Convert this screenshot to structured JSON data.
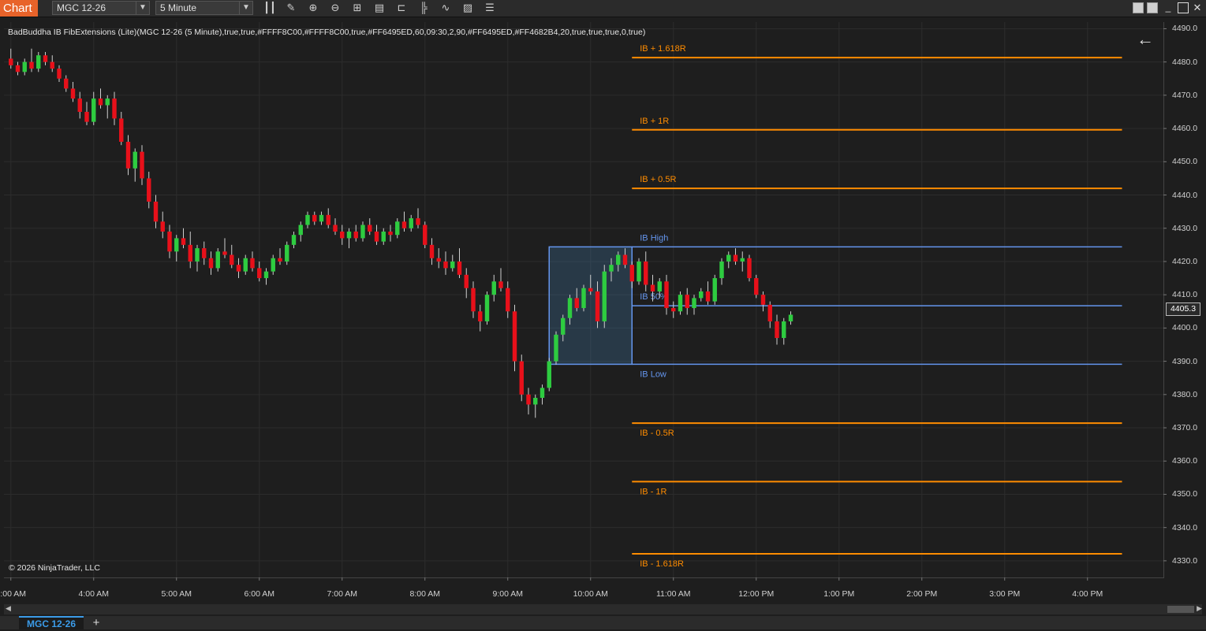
{
  "toolbar": {
    "app_tab": "Chart",
    "instrument": "MGC 12-26",
    "interval": "5 Minute",
    "icons": [
      "bar-type-icon",
      "draw-pencil-icon",
      "zoom-in-icon",
      "zoom-out-icon",
      "crosshair-icon",
      "data-box-icon",
      "strategy-icon",
      "indicator-icon",
      "trend-line-icon",
      "properties-icon",
      "list-icon"
    ]
  },
  "indicator_label": "BadBuddha IB FibExtensions (Lite)(MGC 12-26 (5 Minute),true,true,#FFFF8C00,#FFFF8C00,true,#FF6495ED,60,09:30,2,90,#FF6495ED,#FF4682B4,20,true,true,true,0,true)",
  "copyright": "© 2026 NinjaTrader, LLC",
  "last_price": "4405.3",
  "price_ticks": [
    "4490.0",
    "4480.0",
    "4470.0",
    "4460.0",
    "4450.0",
    "4440.0",
    "4430.0",
    "4420.0",
    "4410.0",
    "4400.0",
    "4390.0",
    "4380.0",
    "4370.0",
    "4360.0",
    "4350.0",
    "4340.0",
    "4330.0"
  ],
  "time_ticks": [
    "3:00 AM",
    "4:00 AM",
    "5:00 AM",
    "6:00 AM",
    "7:00 AM",
    "8:00 AM",
    "9:00 AM",
    "10:00 AM",
    "11:00 AM",
    "12:00 PM",
    "1:00 PM",
    "2:00 PM",
    "3:00 PM",
    "4:00 PM"
  ],
  "bottom_tab": "MGC 12-26",
  "add_tab": "+",
  "colors": {
    "up": "#2ecc40",
    "down": "#e8101a",
    "fib": "#ff8c00",
    "ib": "#6495ed",
    "ibfill": "#4682b4",
    "bg": "#1e1e1e",
    "grid": "#2c2c2c"
  },
  "chart_data": {
    "type": "candlestick",
    "y_range": [
      4325,
      4492
    ],
    "x_range": [
      "02:55",
      "16:55"
    ],
    "levels": [
      {
        "label": "IB + 1.618R",
        "price": 4481.3,
        "kind": "fib"
      },
      {
        "label": "IB + 1R",
        "price": 4459.6,
        "kind": "fib"
      },
      {
        "label": "IB + 0.5R",
        "price": 4442.0,
        "kind": "fib"
      },
      {
        "label": "IB High",
        "price": 4424.4,
        "kind": "ib"
      },
      {
        "label": "IB 50%",
        "price": 4406.7,
        "kind": "ib"
      },
      {
        "label": "IB Low",
        "price": 4389.1,
        "kind": "ib"
      },
      {
        "label": "IB - 0.5R",
        "price": 4371.4,
        "kind": "fib"
      },
      {
        "label": "IB - 1R",
        "price": 4353.8,
        "kind": "fib"
      },
      {
        "label": "IB - 1.618R",
        "price": 4332.1,
        "kind": "fib"
      }
    ],
    "ib_window": {
      "start": "09:30",
      "end": "10:30",
      "high": 4424.4,
      "low": 4389.1
    },
    "candles": [
      [
        4481,
        4484,
        4478,
        4479
      ],
      [
        4479,
        4480,
        4476,
        4477
      ],
      [
        4477,
        4481,
        4476,
        4480
      ],
      [
        4480,
        4484,
        4477,
        4478
      ],
      [
        4478,
        4483,
        4477,
        4482
      ],
      [
        4482,
        4483,
        4479,
        4480
      ],
      [
        4480,
        4482,
        4477,
        4478
      ],
      [
        4478,
        4479,
        4474,
        4475
      ],
      [
        4475,
        4476,
        4471,
        4472
      ],
      [
        4472,
        4474,
        4468,
        4469
      ],
      [
        4469,
        4471,
        4463,
        4465
      ],
      [
        4465,
        4468,
        4461,
        4462
      ],
      [
        4462,
        4471,
        4461,
        4469
      ],
      [
        4469,
        4472,
        4466,
        4467
      ],
      [
        4467,
        4470,
        4463,
        4469
      ],
      [
        4469,
        4471,
        4461,
        4463
      ],
      [
        4463,
        4465,
        4455,
        4456
      ],
      [
        4456,
        4458,
        4446,
        4448
      ],
      [
        4448,
        4454,
        4444,
        4453
      ],
      [
        4453,
        4455,
        4443,
        4445
      ],
      [
        4445,
        4447,
        4436,
        4438
      ],
      [
        4438,
        4440,
        4430,
        4432
      ],
      [
        4432,
        4435,
        4427,
        4429
      ],
      [
        4429,
        4431,
        4421,
        4423
      ],
      [
        4423,
        4428,
        4420,
        4427
      ],
      [
        4427,
        4430,
        4424,
        4425
      ],
      [
        4425,
        4429,
        4418,
        4420
      ],
      [
        4420,
        4425,
        4417,
        4424
      ],
      [
        4424,
        4426,
        4419,
        4421
      ],
      [
        4421,
        4423,
        4416,
        4418
      ],
      [
        4418,
        4424,
        4417,
        4423
      ],
      [
        4423,
        4427,
        4421,
        4422
      ],
      [
        4422,
        4425,
        4418,
        4419
      ],
      [
        4419,
        4421,
        4415,
        4417
      ],
      [
        4417,
        4422,
        4416,
        4421
      ],
      [
        4421,
        4423,
        4417,
        4418
      ],
      [
        4418,
        4420,
        4414,
        4415
      ],
      [
        4415,
        4418,
        4413,
        4417
      ],
      [
        4417,
        4422,
        4416,
        4421
      ],
      [
        4421,
        4424,
        4419,
        4420
      ],
      [
        4420,
        4426,
        4419,
        4425
      ],
      [
        4425,
        4429,
        4424,
        4428
      ],
      [
        4428,
        4432,
        4426,
        4431
      ],
      [
        4431,
        4435,
        4430,
        4434
      ],
      [
        4434,
        4435,
        4431,
        4432
      ],
      [
        4432,
        4435,
        4431,
        4434
      ],
      [
        4434,
        4436,
        4430,
        4431
      ],
      [
        4431,
        4433,
        4428,
        4429
      ],
      [
        4429,
        4431,
        4425,
        4427
      ],
      [
        4427,
        4430,
        4424,
        4429
      ],
      [
        4429,
        4431,
        4426,
        4427
      ],
      [
        4427,
        4432,
        4426,
        4431
      ],
      [
        4431,
        4433,
        4428,
        4429
      ],
      [
        4429,
        4431,
        4425,
        4426
      ],
      [
        4426,
        4430,
        4425,
        4429
      ],
      [
        4429,
        4431,
        4426,
        4428
      ],
      [
        4428,
        4433,
        4427,
        4432
      ],
      [
        4432,
        4435,
        4429,
        4430
      ],
      [
        4430,
        4434,
        4429,
        4433
      ],
      [
        4433,
        4436,
        4430,
        4431
      ],
      [
        4431,
        4432,
        4424,
        4425
      ],
      [
        4425,
        4427,
        4419,
        4421
      ],
      [
        4421,
        4424,
        4418,
        4420
      ],
      [
        4420,
        4423,
        4416,
        4418
      ],
      [
        4418,
        4422,
        4417,
        4420
      ],
      [
        4420,
        4424,
        4415,
        4416
      ],
      [
        4416,
        4418,
        4409,
        4412
      ],
      [
        4412,
        4414,
        4403,
        4405
      ],
      [
        4405,
        4407,
        4399,
        4402
      ],
      [
        4402,
        4411,
        4401,
        4410
      ],
      [
        4410,
        4416,
        4408,
        4414
      ],
      [
        4414,
        4418,
        4411,
        4412
      ],
      [
        4412,
        4414,
        4403,
        4405
      ],
      [
        4405,
        4407,
        4387,
        4390
      ],
      [
        4390,
        4392,
        4378,
        4380
      ],
      [
        4380,
        4382,
        4374,
        4377
      ],
      [
        4377,
        4380,
        4373,
        4379
      ],
      [
        4379,
        4383,
        4377,
        4382
      ],
      [
        4382,
        4391,
        4381,
        4390
      ],
      [
        4390,
        4399,
        4389,
        4398
      ],
      [
        4398,
        4404,
        4396,
        4403
      ],
      [
        4403,
        4410,
        4401,
        4409
      ],
      [
        4409,
        4412,
        4405,
        4406
      ],
      [
        4406,
        4413,
        4405,
        4412
      ],
      [
        4412,
        4416,
        4410,
        4411
      ],
      [
        4411,
        4414,
        4400,
        4402
      ],
      [
        4402,
        4419,
        4400,
        4417
      ],
      [
        4417,
        4421,
        4414,
        4419
      ],
      [
        4419,
        4423,
        4417,
        4422
      ],
      [
        4422,
        4424,
        4418,
        4419
      ],
      [
        4419,
        4420,
        4412,
        4414
      ],
      [
        4414,
        4421,
        4413,
        4420
      ],
      [
        4420,
        4423,
        4411,
        4413
      ],
      [
        4413,
        4416,
        4408,
        4411
      ],
      [
        4411,
        4415,
        4409,
        4414
      ],
      [
        4414,
        4416,
        4404,
        4406
      ],
      [
        4406,
        4408,
        4403,
        4405
      ],
      [
        4405,
        4411,
        4404,
        4410
      ],
      [
        4410,
        4412,
        4404,
        4406
      ],
      [
        4406,
        4410,
        4404,
        4409
      ],
      [
        4409,
        4412,
        4408,
        4411
      ],
      [
        4411,
        4414,
        4407,
        4408
      ],
      [
        4408,
        4416,
        4407,
        4415
      ],
      [
        4415,
        4421,
        4413,
        4420
      ],
      [
        4420,
        4423,
        4418,
        4422
      ],
      [
        4422,
        4424,
        4419,
        4420
      ],
      [
        4420,
        4423,
        4417,
        4421
      ],
      [
        4421,
        4422,
        4414,
        4415
      ],
      [
        4415,
        4416,
        4409,
        4410
      ],
      [
        4410,
        4411,
        4405,
        4407
      ],
      [
        4407,
        4408,
        4400,
        4402
      ],
      [
        4402,
        4404,
        4395,
        4397
      ],
      [
        4397,
        4403,
        4395,
        4402
      ],
      [
        4402,
        4405,
        4401,
        4404
      ]
    ]
  }
}
